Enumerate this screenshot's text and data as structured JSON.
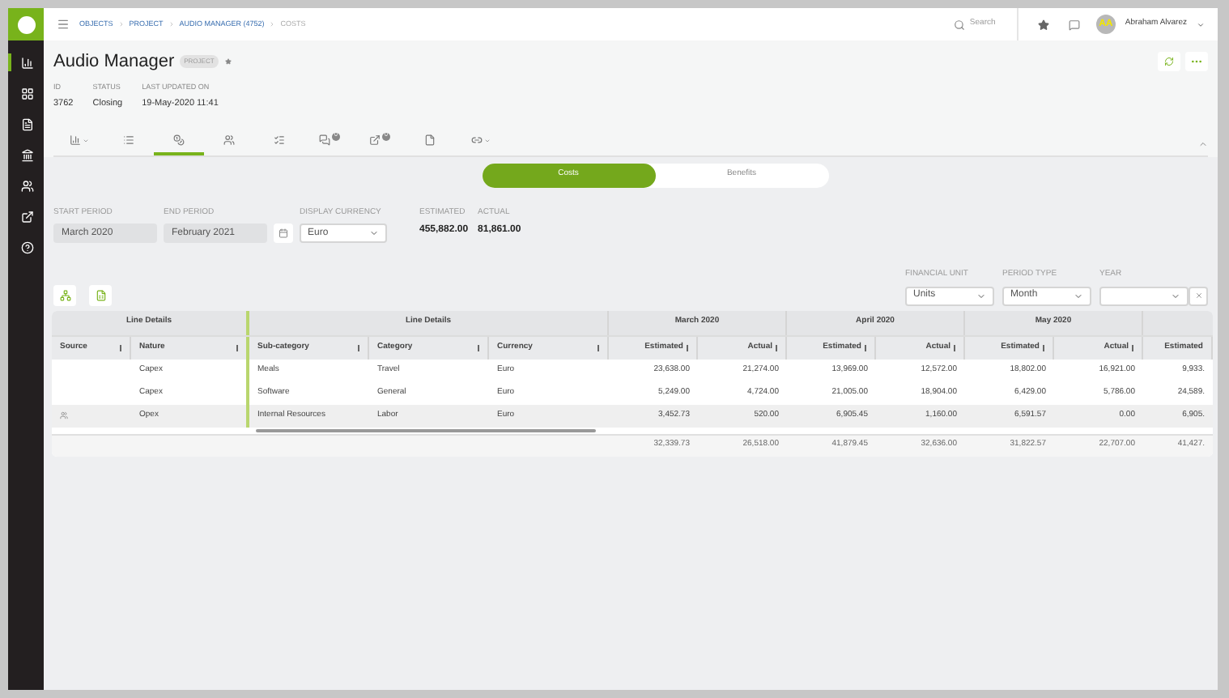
{
  "sidebar": {
    "items": [
      {
        "kind": "chart",
        "selected": true
      },
      {
        "kind": "grid",
        "selected": false
      },
      {
        "kind": "document",
        "selected": false
      },
      {
        "kind": "bank",
        "selected": false
      },
      {
        "kind": "people",
        "selected": false
      },
      {
        "kind": "external",
        "selected": false
      },
      {
        "kind": "help",
        "selected": false
      }
    ]
  },
  "breadcrumbs": [
    "OBJECTS",
    "PROJECT",
    "AUDIO MANAGER (4752)",
    "COSTS"
  ],
  "search": {
    "placeholder": "Search"
  },
  "user": {
    "initials": "AA",
    "name": "Abraham Alvarez"
  },
  "header": {
    "title": "Audio Manager",
    "badge": "PROJECT",
    "fields": [
      {
        "label": "ID",
        "value": "3762"
      },
      {
        "label": "STATUS",
        "value": "Closing"
      },
      {
        "label": "LAST UPDATED ON",
        "value": "19-May-2020 11:41"
      }
    ]
  },
  "tabs": [
    {
      "kind": "chart",
      "selected": false,
      "dropdown": true
    },
    {
      "kind": "list",
      "selected": false
    },
    {
      "kind": "costs",
      "selected": true
    },
    {
      "kind": "team",
      "selected": false
    },
    {
      "kind": "checklist",
      "selected": false
    },
    {
      "kind": "comments",
      "selected": false,
      "badge": "0"
    },
    {
      "kind": "share",
      "selected": false,
      "badge": "0"
    },
    {
      "kind": "file",
      "selected": false
    },
    {
      "kind": "link",
      "selected": false,
      "dropdown": true
    }
  ],
  "toggle": [
    {
      "label": "Costs",
      "selected": true
    },
    {
      "label": "Benefits",
      "selected": false
    }
  ],
  "filters": {
    "start_period": {
      "label": "START PERIOD",
      "value": "March 2020"
    },
    "end_period": {
      "label": "END PERIOD",
      "value": "February 2021"
    },
    "display_currency": {
      "label": "DISPLAY CURRENCY",
      "value": "Euro"
    }
  },
  "totals": [
    {
      "label": "ESTIMATED",
      "value": "455,882.00"
    },
    {
      "label": "ACTUAL",
      "value": "81,861.00"
    }
  ],
  "table_filters": [
    {
      "label": "FINANCIAL UNIT",
      "value": "Units"
    },
    {
      "label": "PERIOD TYPE",
      "value": "Month"
    },
    {
      "label": "YEAR"
    }
  ],
  "table": {
    "groups": [
      "Line Details",
      "Line Details",
      "March 2020",
      "April 2020",
      "May 2020"
    ],
    "columns": [
      "Source",
      "Nature",
      "Sub-category",
      "Category",
      "Currency",
      "Estimated",
      "Actual",
      "Estimated",
      "Actual",
      "Estimated",
      "Actual",
      "Estimated"
    ],
    "rows": [
      {
        "selected": false,
        "source_icon": false,
        "cells": [
          "",
          "Capex",
          "Meals",
          "Travel",
          "Euro",
          "23,638.00",
          "21,274.00",
          "13,969.00",
          "12,572.00",
          "18,802.00",
          "16,921.00",
          "9,933."
        ]
      },
      {
        "selected": false,
        "source_icon": false,
        "cells": [
          "",
          "Capex",
          "Software",
          "General",
          "Euro",
          "5,249.00",
          "4,724.00",
          "21,005.00",
          "18,904.00",
          "6,429.00",
          "5,786.00",
          "24,589."
        ]
      },
      {
        "selected": true,
        "source_icon": true,
        "cells": [
          "",
          "Opex",
          "Internal Resources",
          "Labor",
          "Euro",
          "3,452.73",
          "520.00",
          "6,905.45",
          "1,160.00",
          "6,591.57",
          "0.00",
          "6,905."
        ]
      }
    ],
    "footer": [
      "32,339.73",
      "26,518.00",
      "41,879.45",
      "32,636.00",
      "31,822.57",
      "22,707.00",
      "41,427."
    ]
  }
}
